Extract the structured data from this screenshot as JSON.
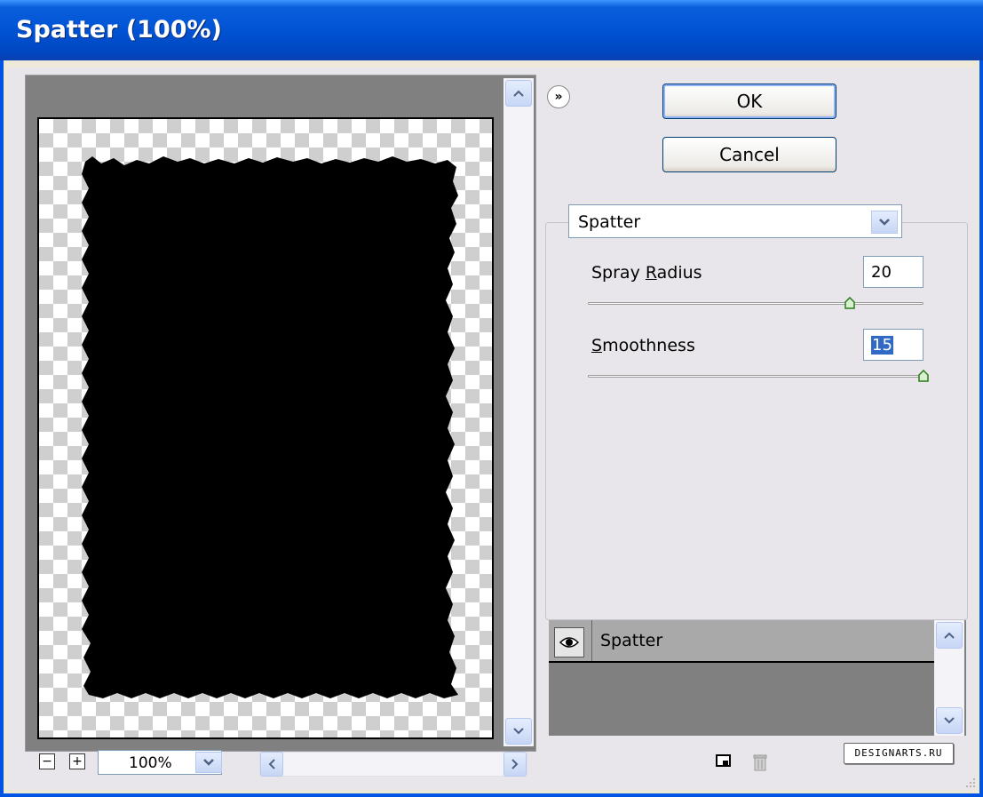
{
  "window": {
    "title": "Spatter (100%)"
  },
  "buttons": {
    "ok": "OK",
    "cancel": "Cancel"
  },
  "filter": {
    "selected": "Spatter"
  },
  "params": [
    {
      "label_pre": "Spray ",
      "label_key": "R",
      "label_post": "adius",
      "value": "20",
      "slider_fraction": 0.78
    },
    {
      "label_pre": "",
      "label_key": "S",
      "label_post": "moothness",
      "value": "15",
      "slider_fraction": 1.0
    }
  ],
  "zoom": {
    "level": "100%"
  },
  "layers": [
    {
      "name": "Spatter",
      "visible": true
    }
  ],
  "watermark": "DESIGNARTS.RU",
  "icons": [
    "expand-chevron-icon",
    "scroll-up-icon",
    "scroll-down-icon",
    "scroll-left-icon",
    "scroll-right-icon",
    "zoom-out-icon",
    "zoom-in-icon",
    "dropdown-arrow-icon",
    "eye-icon",
    "new-effect-layer-icon",
    "trash-icon"
  ]
}
